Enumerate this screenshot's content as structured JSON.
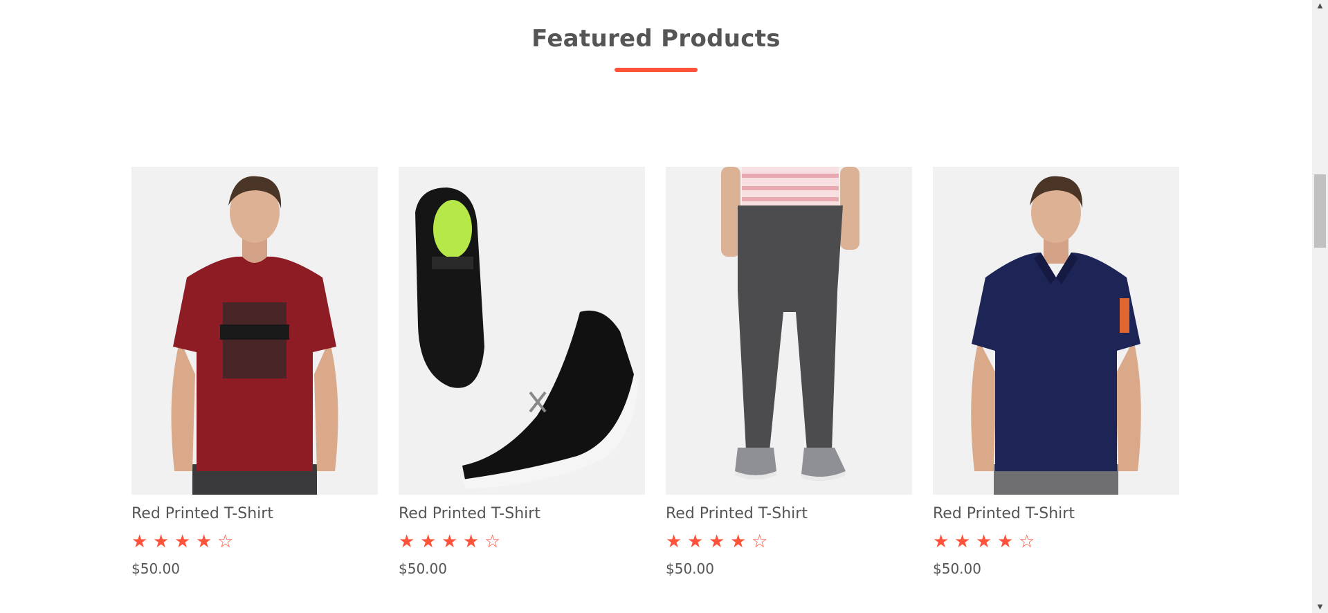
{
  "section": {
    "title": "Featured Products",
    "accent_color": "#ff523b"
  },
  "products": [
    {
      "name": "Red Printed T-Shirt",
      "image": "red-puma-tshirt",
      "rating": 4,
      "rating_max": 5,
      "price": "$50.00"
    },
    {
      "name": "Red Printed T-Shirt",
      "image": "black-hrx-sneakers",
      "rating": 4,
      "rating_max": 5,
      "price": "$50.00"
    },
    {
      "name": "Red Printed T-Shirt",
      "image": "grey-joggers",
      "rating": 4,
      "rating_max": 5,
      "price": "$50.00"
    },
    {
      "name": "Red Printed T-Shirt",
      "image": "navy-puma-polo",
      "rating": 4,
      "rating_max": 5,
      "price": "$50.00"
    }
  ],
  "icons": {
    "star_full": "star-icon",
    "star_empty": "star-outline-icon",
    "scroll_up": "arrow-up-icon",
    "scroll_down": "arrow-down-icon"
  }
}
